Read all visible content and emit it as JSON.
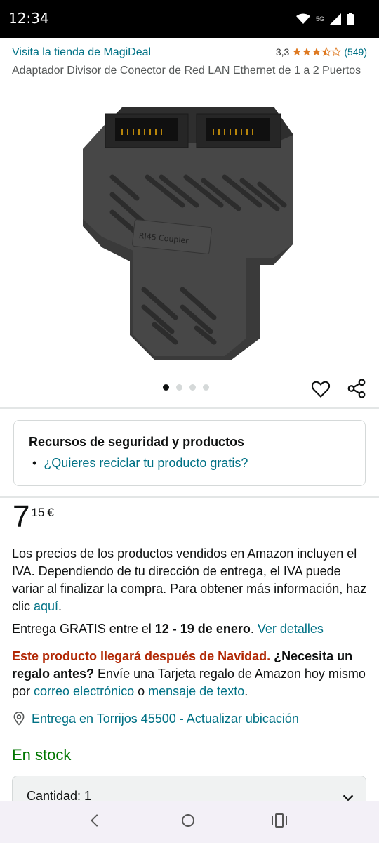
{
  "status_bar": {
    "time": "12:34",
    "network": "5G"
  },
  "store": {
    "link": "Visita la tienda de MagiDeal"
  },
  "rating": {
    "value": "3,3",
    "stars": 3.5,
    "count": "(549)"
  },
  "product": {
    "title": "Adaptador Divisor de Conector de Red LAN Ethernet de 1 a 2 Puertos"
  },
  "gallery": {
    "image_count": 4,
    "active_index": 0,
    "image_label": "RJ45 Coupler"
  },
  "safety": {
    "title": "Recursos de seguridad y productos",
    "item": "¿Quieres reciclar tu producto gratis?"
  },
  "price": {
    "whole": "7",
    "fraction": "15",
    "currency": "€"
  },
  "vat": {
    "text": "Los precios de los productos vendidos en Amazon incluyen el IVA. Dependiendo de tu dirección de entrega, el IVA puede variar al finalizar la compra. Para obtener más información, haz clic ",
    "link": "aquí",
    "end": "."
  },
  "delivery": {
    "prefix": "Entrega GRATIS entre el ",
    "dates": "12 - 19 de enero",
    "dot": ". ",
    "details_link": "Ver detalles"
  },
  "christmas": {
    "warning": "Este producto llegará después de Navidad.",
    "question": " ¿Necesita un regalo antes?",
    "text": " Envíe una Tarjeta regalo de Amazon hoy mismo por ",
    "email_link": "correo electrónico",
    "or": " o ",
    "sms_link": "mensaje de texto",
    "end": "."
  },
  "location": {
    "text": "Entrega en Torrijos 45500 - Actualizar ubicación"
  },
  "stock": {
    "text": "En stock"
  },
  "quantity": {
    "label": "Cantidad: 1"
  },
  "colors": {
    "link": "#007185",
    "price_red": "#b12704",
    "stock_green": "#007600",
    "star": "#de7921"
  }
}
